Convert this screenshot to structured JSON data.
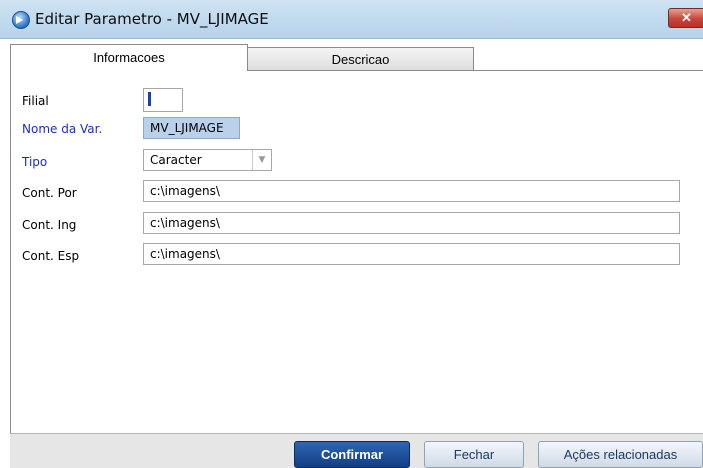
{
  "window": {
    "title": "Editar Parametro - MV_LJIMAGE",
    "close_glyph": "✕"
  },
  "tabs": [
    {
      "label": "Informacoes",
      "active": true
    },
    {
      "label": "Descricao",
      "active": false
    }
  ],
  "form": {
    "filial": {
      "label": "Filial",
      "value": ""
    },
    "nome_var": {
      "label": "Nome da Var.",
      "value": "MV_LJIMAGE"
    },
    "tipo": {
      "label": "Tipo",
      "value": "Caracter",
      "arrow": "▼"
    },
    "cont_por": {
      "label": "Cont. Por",
      "value": "c:\\imagens\\"
    },
    "cont_ing": {
      "label": "Cont. Ing",
      "value": "c:\\imagens\\"
    },
    "cont_esp": {
      "label": "Cont. Esp",
      "value": "c:\\imagens\\"
    }
  },
  "buttons": {
    "confirmar": "Confirmar",
    "fechar": "Fechar",
    "acoes": "Ações relacionadas"
  },
  "colors": {
    "required_label": "#1b2dc8",
    "confirm_button": "#1a4d96",
    "readonly_field": "#b9d1ea"
  },
  "icons": {
    "app": "app-arrow-icon",
    "close": "close-icon",
    "combo": "chevron-down-icon"
  }
}
